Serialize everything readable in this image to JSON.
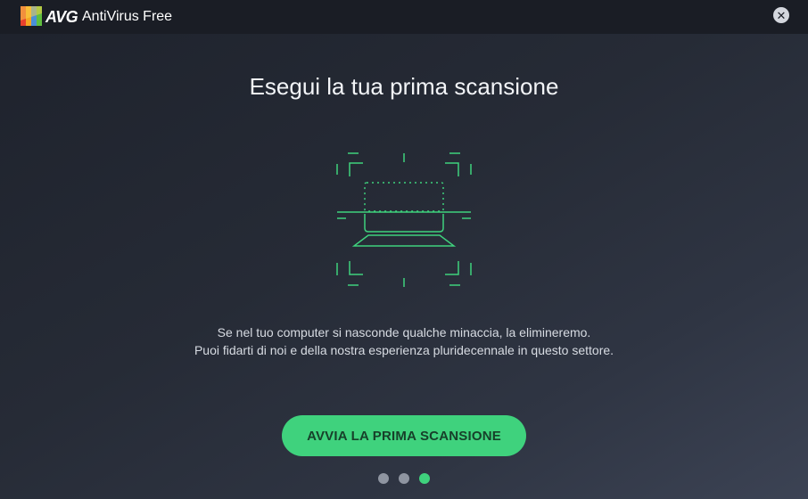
{
  "window": {
    "brand": "AVG",
    "product": "AntiVirus Free",
    "close_glyph": "✕"
  },
  "main": {
    "heading": "Esegui la tua prima scansione",
    "description_line1": "Se nel tuo computer si nasconde qualche minaccia, la elimineremo.",
    "description_line2": "Puoi fidarti di noi e della nostra esperienza pluridecennale in questo settore.",
    "cta_label": "AVVIA LA PRIMA SCANSIONE",
    "illustration_icon": "laptop-scan-icon"
  },
  "pagination": {
    "total": 3,
    "active_index": 2
  },
  "colors": {
    "accent": "#3fd27d",
    "titlebar": "#1a1d25",
    "background": "#262b36",
    "dot_inactive": "#8f95a1"
  }
}
